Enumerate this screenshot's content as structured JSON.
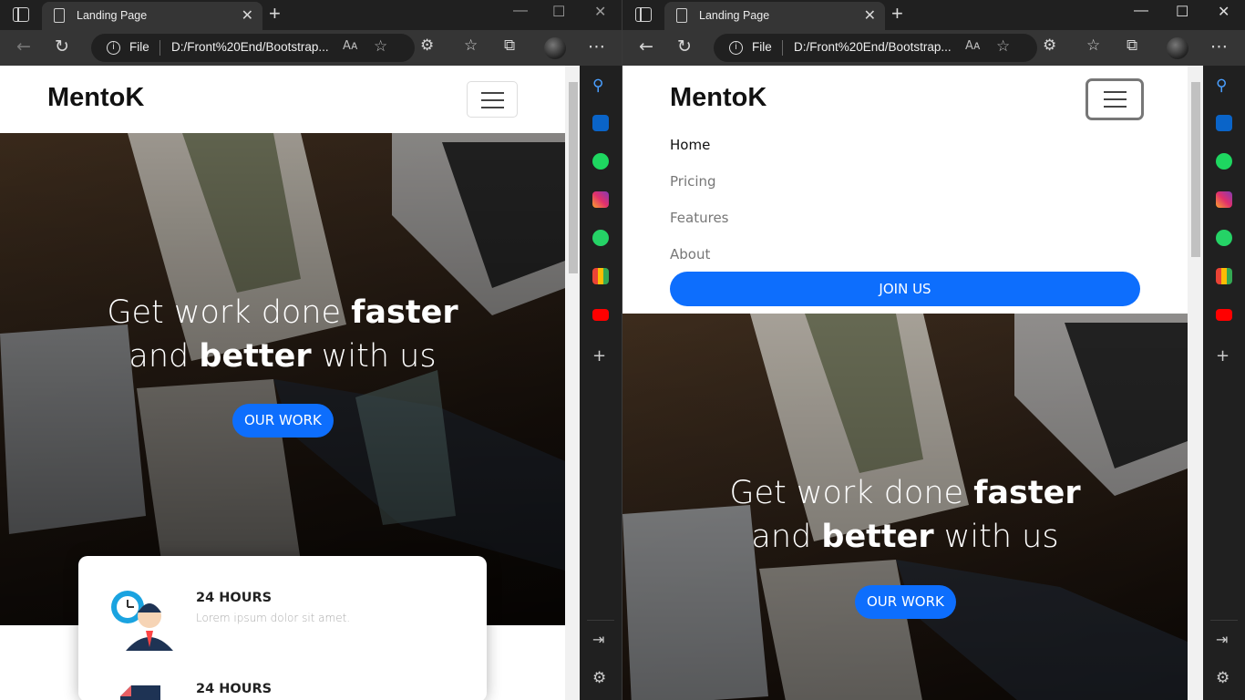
{
  "browser": {
    "tab_title": "Landing Page",
    "file_label": "File",
    "url": "D:/Front%20End/Bootstrap...",
    "read_aloud": "Aᴀ",
    "new_tab": "+",
    "close_tab": "✕",
    "win_min": "—",
    "win_max": "☐",
    "win_close": "✕",
    "back": "←",
    "reload": "↻",
    "more": "⋯"
  },
  "sidebar_icons": [
    "search-icon",
    "outlook-icon",
    "spotify-icon",
    "instagram-icon",
    "whatsapp-icon",
    "gmail-icon",
    "youtube-icon"
  ],
  "sidebar_add": "+",
  "page": {
    "brand": "MentoK",
    "hero_line1_normal": "Get work done ",
    "hero_line1_bold": "faster",
    "hero_line2_normal1": "and ",
    "hero_line2_bold": "better",
    "hero_line2_normal2": " with us",
    "cta": "OUR WORK",
    "menu": [
      {
        "label": "Home",
        "active": true
      },
      {
        "label": "Pricing",
        "active": false
      },
      {
        "label": "Features",
        "active": false
      },
      {
        "label": "About",
        "active": false
      }
    ],
    "join": "JOIN US",
    "features": [
      {
        "title": "24 HOURS",
        "desc": "Lorem ipsum dolor sit amet."
      },
      {
        "title": "24 HOURS",
        "desc": ""
      }
    ]
  },
  "colors": {
    "primary": "#0d6efd",
    "brand_text": "#111111",
    "browser_chrome": "#202020"
  }
}
